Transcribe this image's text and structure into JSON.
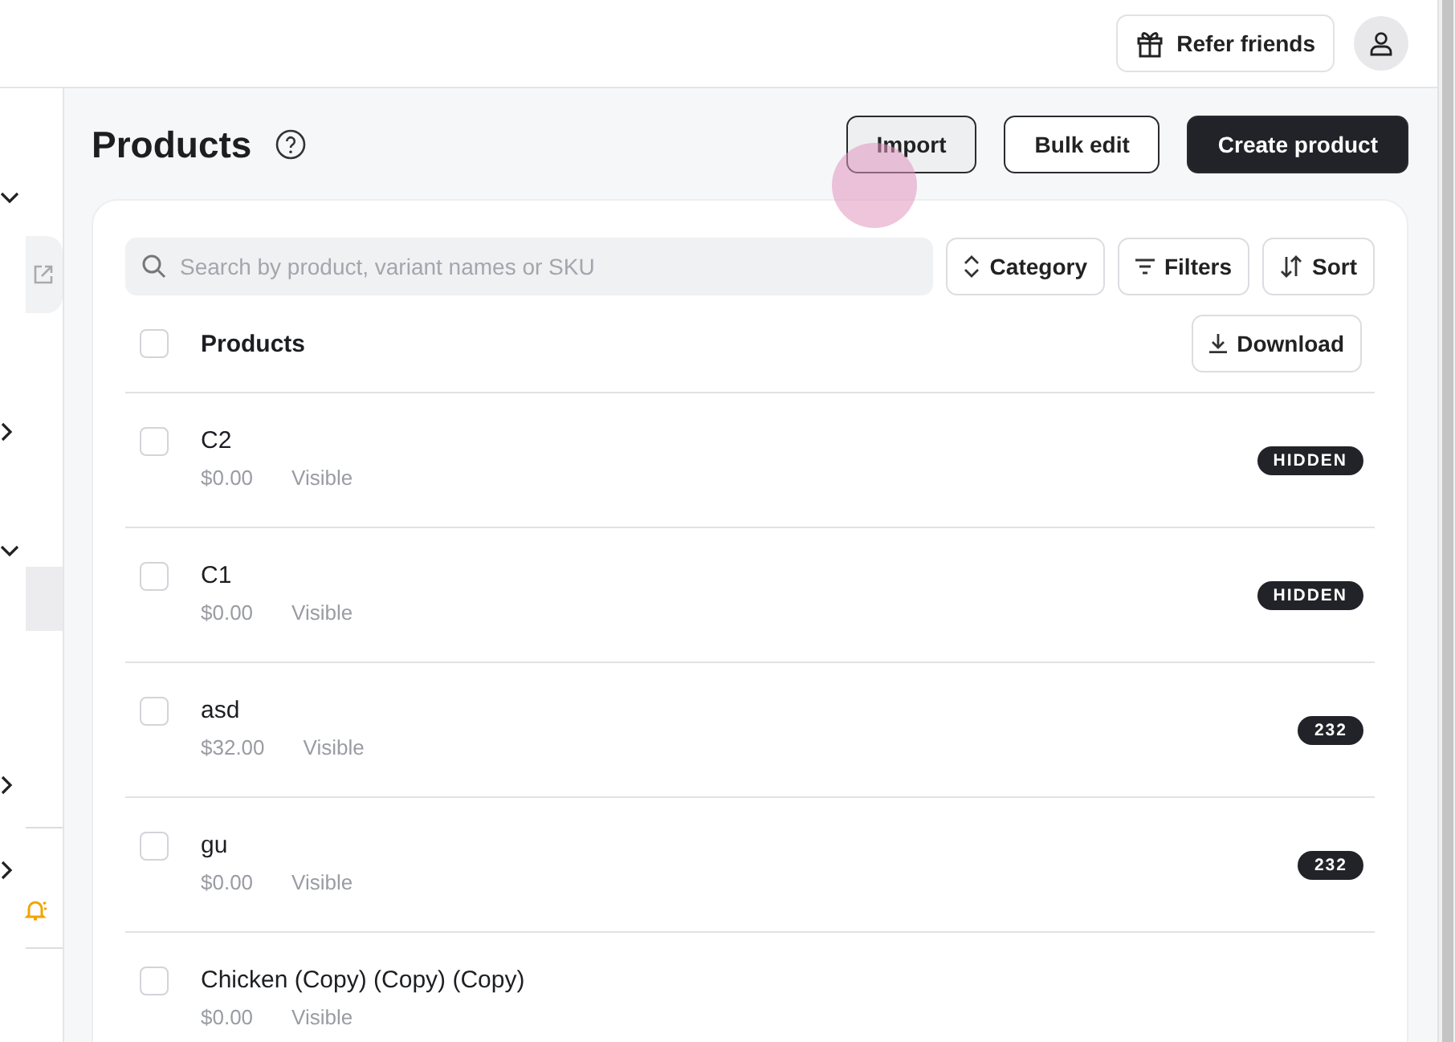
{
  "topbar": {
    "refer_button": "Refer friends"
  },
  "sidebar": {
    "items": [
      {
        "kind": "group",
        "expanded": true
      },
      {
        "kind": "link"
      },
      {
        "kind": "group",
        "expanded": false
      },
      {
        "kind": "group",
        "expanded": true
      },
      {
        "kind": "entry",
        "selected": true
      },
      {
        "kind": "group",
        "expanded": false
      },
      {
        "kind": "divider"
      },
      {
        "kind": "group",
        "expanded": false
      },
      {
        "kind": "alert"
      },
      {
        "kind": "divider"
      }
    ]
  },
  "page": {
    "title": "Products",
    "buttons": [
      {
        "label": "Import",
        "kind": "pressed"
      },
      {
        "label": "Bulk edit",
        "kind": "outline"
      },
      {
        "label": "Create product",
        "kind": "primary"
      }
    ]
  },
  "toolbar": {
    "search_placeholder": "Search by product, variant names or SKU",
    "buttons": [
      {
        "label": "Category",
        "kind": "category"
      },
      {
        "label": "Filters",
        "kind": "filters"
      },
      {
        "label": "Sort",
        "kind": "sort"
      }
    ]
  },
  "table": {
    "header": {
      "label": "Products",
      "checked": false
    },
    "download_button": "Download",
    "rows": [
      {
        "name": "C2",
        "price": "$0.00",
        "status": "Visible",
        "checked": false,
        "badge": "HIDDEN"
      },
      {
        "name": "C1",
        "price": "$0.00",
        "status": "Visible",
        "checked": false,
        "badge": "HIDDEN"
      },
      {
        "name": "asd",
        "price": "$32.00",
        "status": "Visible",
        "checked": false,
        "badge": "232"
      },
      {
        "name": "gu",
        "price": "$0.00",
        "status": "Visible",
        "checked": false,
        "badge": "232"
      },
      {
        "name": "Chicken (Copy) (Copy) (Copy)",
        "price": "$0.00",
        "status": "Visible",
        "checked": false
      }
    ]
  }
}
